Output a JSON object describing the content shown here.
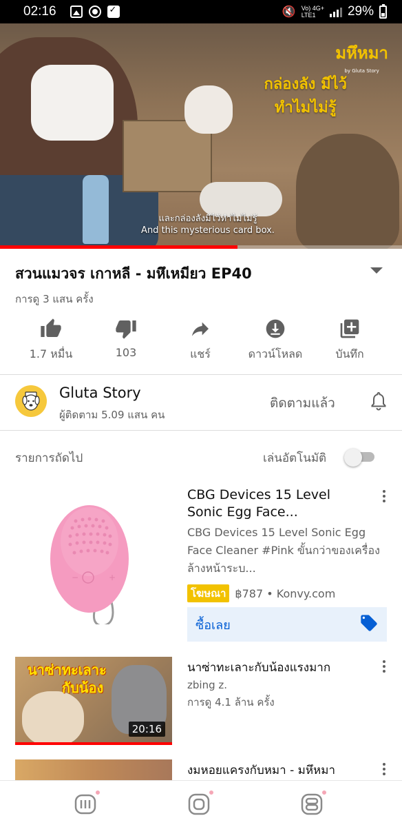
{
  "status_bar": {
    "time": "02:16",
    "network_top": "Vo) 4G+",
    "network_bottom": "LTE1",
    "battery": "29%"
  },
  "video": {
    "overlay_title_line1": "กล่องลัง มีไว้",
    "overlay_title_line2": "ทำไมไม่รู้",
    "brand_logo": "มหึหมา",
    "brand_sub": "by Gluta Story",
    "subtitle_th": "และกล่องลังมีไว้ทำไมไม่รู้",
    "subtitle_en": "And this mysterious card box.",
    "progress_fraction": 0.59,
    "title": "สวนแมวจร เกาหลี  - มหึเหมียว EP40",
    "views": "การดู 3 แสน ครั้ง"
  },
  "actions": [
    {
      "icon": "thumb-up-icon",
      "label": "1.7 หมื่น"
    },
    {
      "icon": "thumb-down-icon",
      "label": "103"
    },
    {
      "icon": "share-icon",
      "label": "แชร์"
    },
    {
      "icon": "download-icon",
      "label": "ดาวน์โหลด"
    },
    {
      "icon": "add-to-playlist-icon",
      "label": "บันทึก"
    }
  ],
  "channel": {
    "name": "Gluta Story",
    "subscribers": "ผู้ติดตาม 5.09 แสน คน",
    "subscribe_state": "ติดตามแล้ว"
  },
  "up_next": {
    "label": "รายการถัดไป",
    "autoplay_label": "เล่นอัตโนมัติ",
    "autoplay_on": false
  },
  "ad": {
    "title": "CBG Devices 15 Level Sonic Egg Face...",
    "description": "CBG Devices 15 Level Sonic Egg Face Cleaner #Pink ขั้นกว่าของเครื่องล้างหน้าระบ...",
    "badge": "โฆษณา",
    "price_source": "฿787 • Konvy.com",
    "cta": "ซื้อเลย",
    "product_color": "#f59bc0"
  },
  "videos": [
    {
      "title": "นาซ่าทะเลาะกับน้องแรงมาก",
      "channel": "zbing z.",
      "views": "การดู 4.1 ล้าน ครั้ง",
      "duration": "20:16",
      "thumb_text_line1": "นาซ่าทะเลาะ",
      "thumb_text_line2": "กับน้อง"
    },
    {
      "title": "งมหอยแครงกับหมา - มหึหมา"
    }
  ],
  "colors": {
    "accent_red": "#ff0000",
    "link_blue": "#065fd4",
    "ad_yellow": "#f2c200"
  }
}
